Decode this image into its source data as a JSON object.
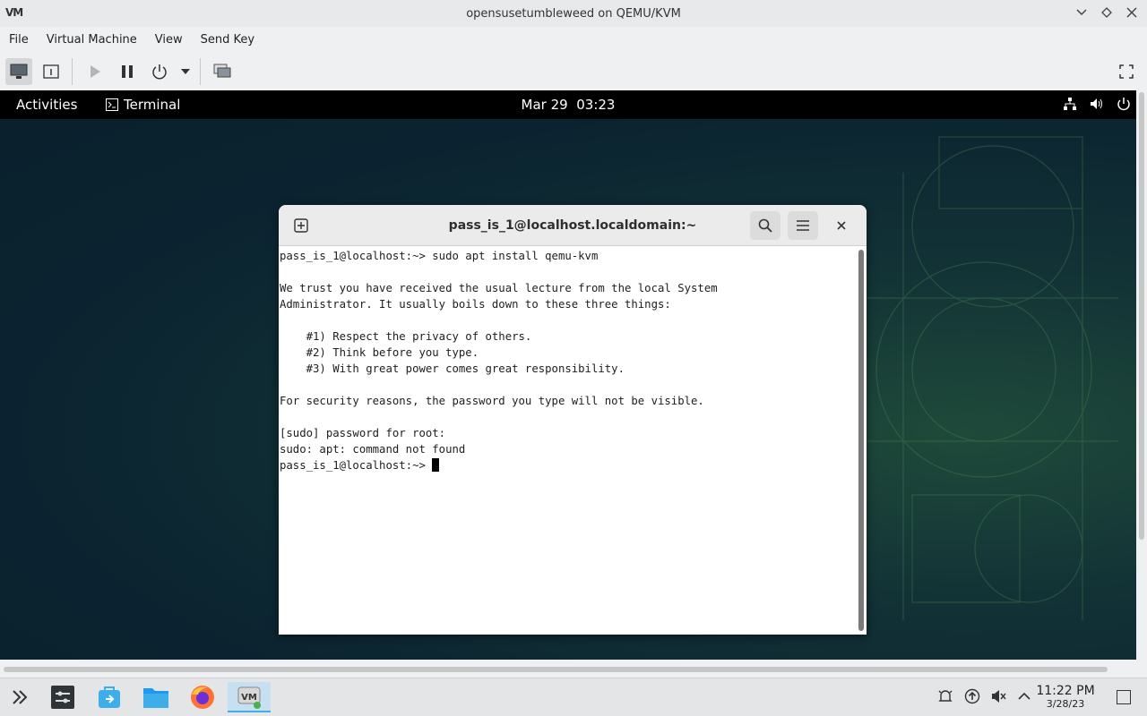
{
  "window": {
    "title": "opensusetumbleweed on QEMU/KVM",
    "logo": "VM"
  },
  "menubar": {
    "items": [
      "File",
      "Virtual Machine",
      "View",
      "Send Key"
    ]
  },
  "guest": {
    "topbar": {
      "activities": "Activities",
      "app_name": "Terminal",
      "date": "Mar 29",
      "time": "03:23"
    },
    "terminal": {
      "title": "pass_is_1@localhost.localdomain:~",
      "lines": [
        "pass_is_1@localhost:~> sudo apt install qemu-kvm",
        "",
        "We trust you have received the usual lecture from the local System",
        "Administrator. It usually boils down to these three things:",
        "",
        "    #1) Respect the privacy of others.",
        "    #2) Think before you type.",
        "    #3) With great power comes great responsibility.",
        "",
        "For security reasons, the password you type will not be visible.",
        "",
        "[sudo] password for root:",
        "sudo: apt: command not found"
      ],
      "prompt": "pass_is_1@localhost:~> "
    }
  },
  "taskbar": {
    "time": "11:22 PM",
    "date": "3/28/23"
  },
  "colors": {
    "accent": "#3daee9",
    "guest_bg": "#0b2330",
    "topbar": "#000000"
  }
}
